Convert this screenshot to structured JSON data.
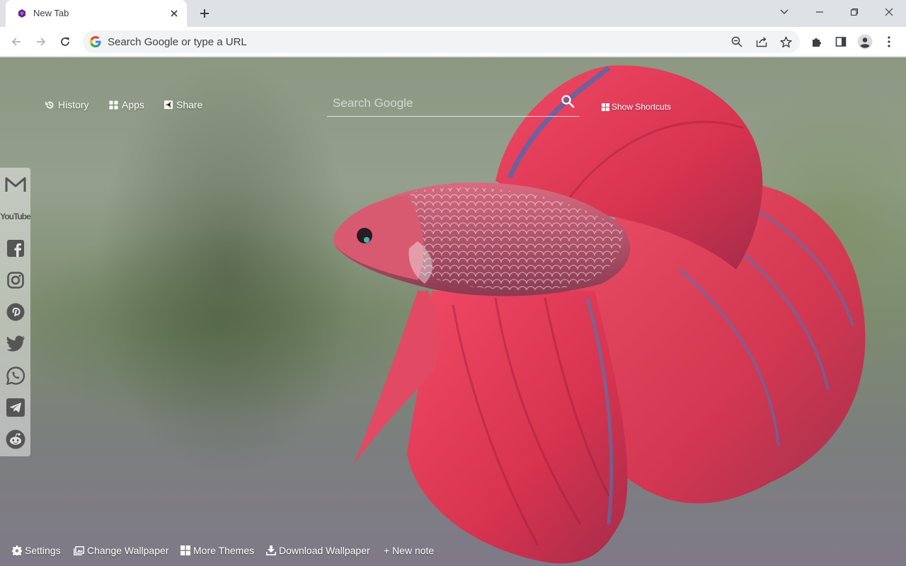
{
  "browser": {
    "tab_title": "New Tab",
    "omnibox_placeholder": "Search Google or type a URL"
  },
  "topnav": {
    "history": "History",
    "apps": "Apps",
    "share": "Share"
  },
  "search": {
    "placeholder": "Search Google",
    "shortcuts_label": "Show Shortcuts"
  },
  "social_links": [
    "gmail-icon",
    "youtube-icon",
    "facebook-icon",
    "instagram-icon",
    "pinterest-icon",
    "twitter-icon",
    "whatsapp-icon",
    "telegram-icon",
    "reddit-icon"
  ],
  "youtube_label": "YouTube",
  "bottombar": {
    "settings": "Settings",
    "change_wallpaper": "Change Wallpaper",
    "more_themes": "More Themes",
    "download_wallpaper": "Download Wallpaper",
    "new_note": "+ New note"
  },
  "colors": {
    "accent_fish": "#e03a55",
    "chrome_frame": "#dee1e6",
    "omnibox_bg": "#f1f3f4"
  }
}
